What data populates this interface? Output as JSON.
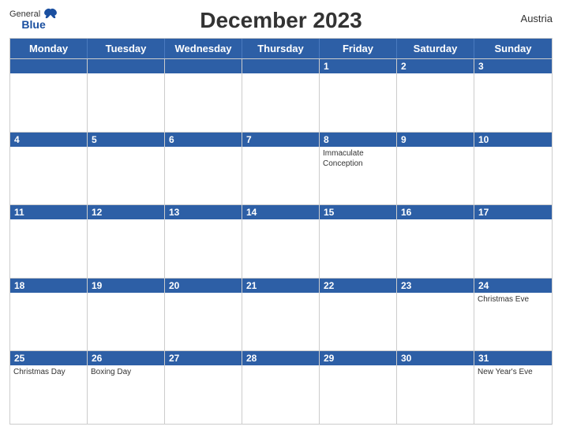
{
  "header": {
    "title": "December 2023",
    "country": "Austria",
    "logo_general": "General",
    "logo_blue": "Blue"
  },
  "weekdays": [
    "Monday",
    "Tuesday",
    "Wednesday",
    "Thursday",
    "Friday",
    "Saturday",
    "Sunday"
  ],
  "weeks": [
    [
      {
        "day": "",
        "event": ""
      },
      {
        "day": "",
        "event": ""
      },
      {
        "day": "",
        "event": ""
      },
      {
        "day": "",
        "event": ""
      },
      {
        "day": "1",
        "event": ""
      },
      {
        "day": "2",
        "event": ""
      },
      {
        "day": "3",
        "event": ""
      }
    ],
    [
      {
        "day": "4",
        "event": ""
      },
      {
        "day": "5",
        "event": ""
      },
      {
        "day": "6",
        "event": ""
      },
      {
        "day": "7",
        "event": ""
      },
      {
        "day": "8",
        "event": "Immaculate Conception"
      },
      {
        "day": "9",
        "event": ""
      },
      {
        "day": "10",
        "event": ""
      }
    ],
    [
      {
        "day": "11",
        "event": ""
      },
      {
        "day": "12",
        "event": ""
      },
      {
        "day": "13",
        "event": ""
      },
      {
        "day": "14",
        "event": ""
      },
      {
        "day": "15",
        "event": ""
      },
      {
        "day": "16",
        "event": ""
      },
      {
        "day": "17",
        "event": ""
      }
    ],
    [
      {
        "day": "18",
        "event": ""
      },
      {
        "day": "19",
        "event": ""
      },
      {
        "day": "20",
        "event": ""
      },
      {
        "day": "21",
        "event": ""
      },
      {
        "day": "22",
        "event": ""
      },
      {
        "day": "23",
        "event": ""
      },
      {
        "day": "24",
        "event": "Christmas Eve"
      }
    ],
    [
      {
        "day": "25",
        "event": "Christmas Day"
      },
      {
        "day": "26",
        "event": "Boxing Day"
      },
      {
        "day": "27",
        "event": ""
      },
      {
        "day": "28",
        "event": ""
      },
      {
        "day": "29",
        "event": ""
      },
      {
        "day": "30",
        "event": ""
      },
      {
        "day": "31",
        "event": "New Year's Eve"
      }
    ]
  ]
}
